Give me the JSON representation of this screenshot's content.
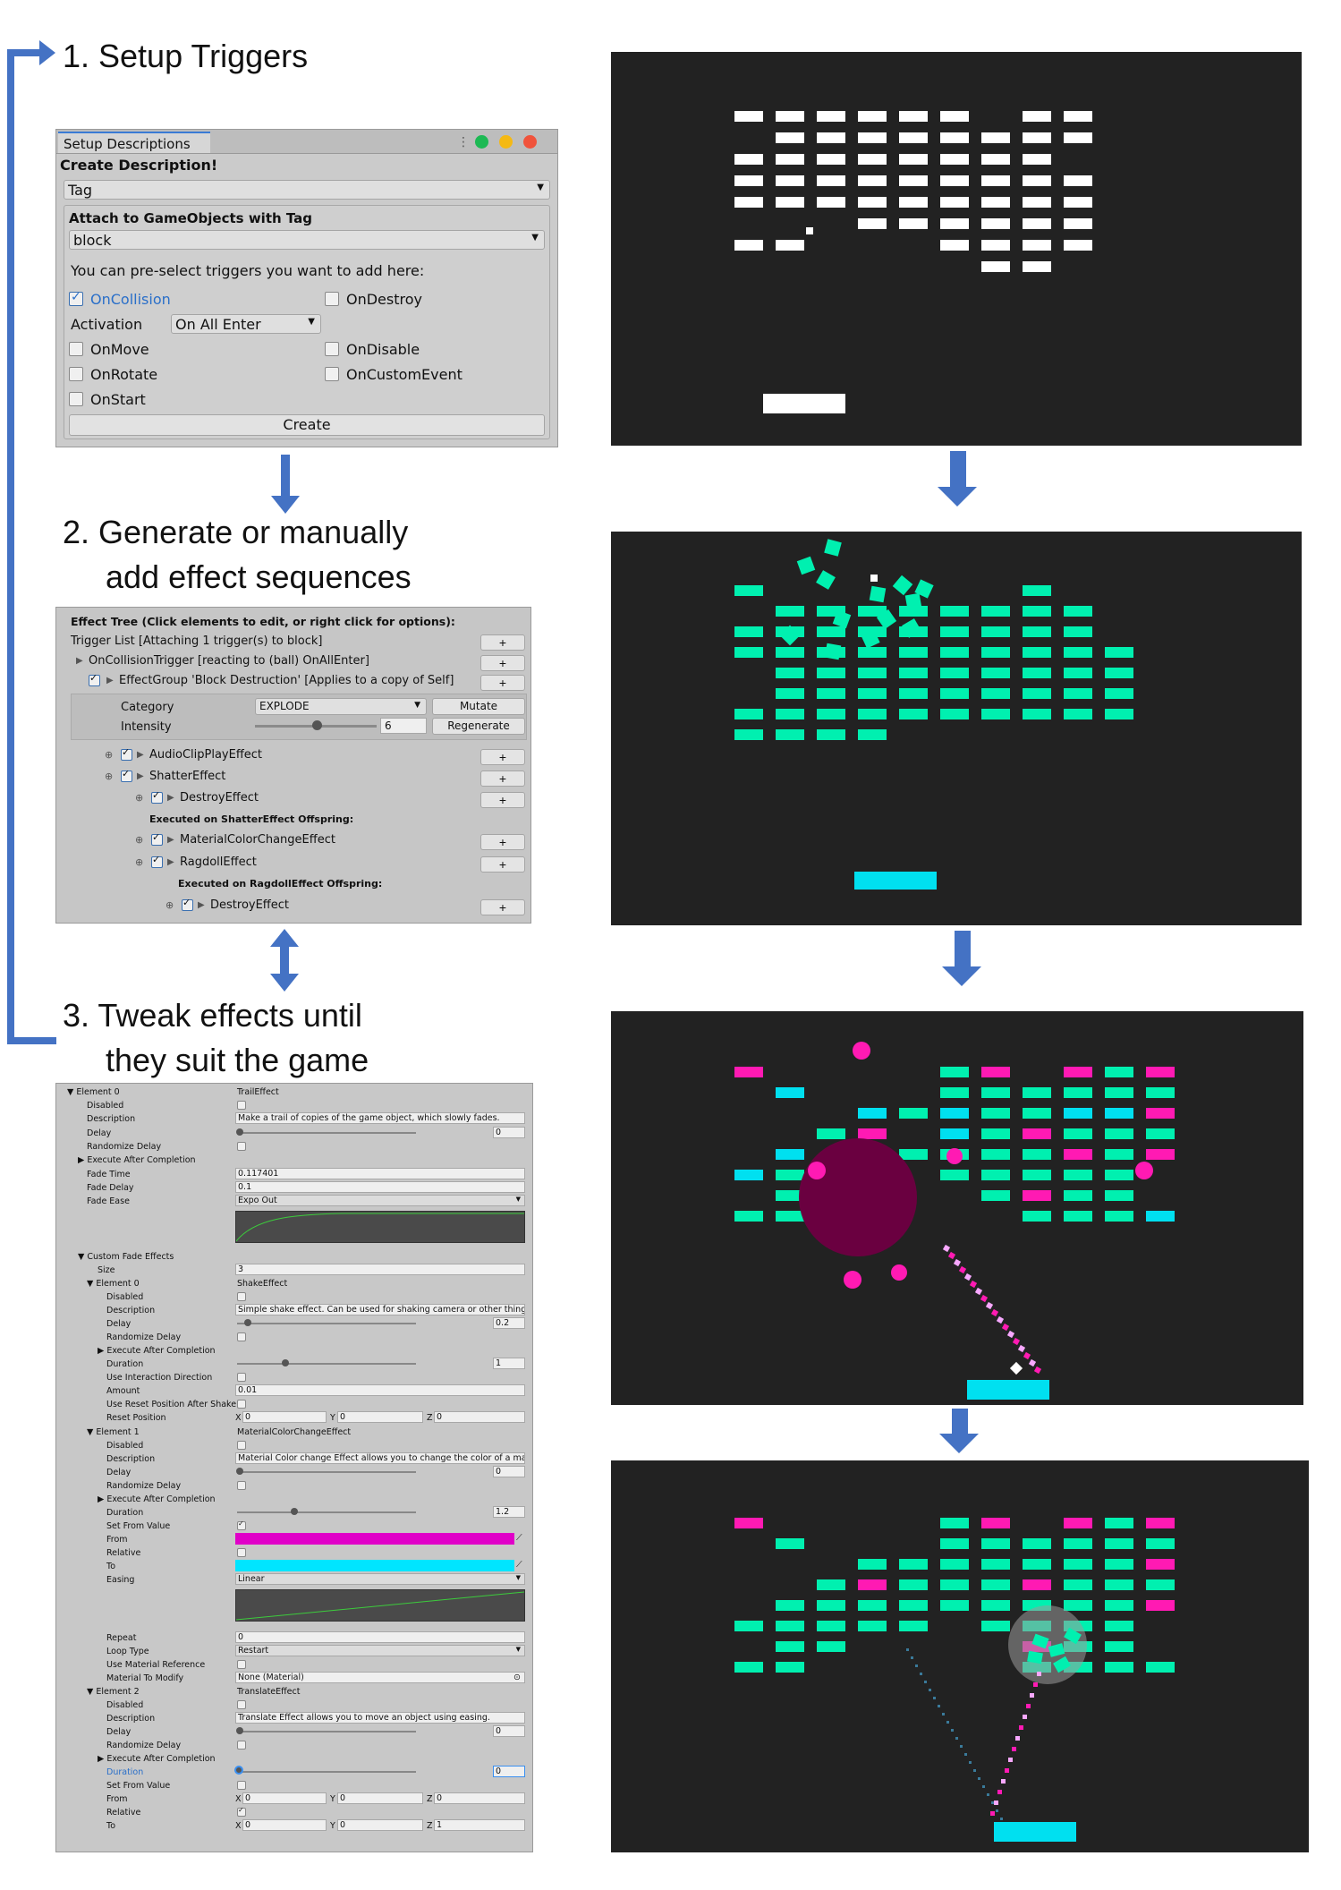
{
  "steps": [
    {
      "title": "1. Setup Triggers"
    },
    {
      "title_l1": "2. Generate or manually",
      "title_l2": "add effect sequences"
    },
    {
      "title_l1": "3. Tweak effects until",
      "title_l2": "they suit the game"
    }
  ],
  "setup_panel": {
    "tab": "Setup Descriptions",
    "header": "Create Description!",
    "type_select": "Tag",
    "attach_label": "Attach to GameObjects with Tag",
    "tag_select": "block",
    "hint": "You can pre-select triggers you want to add here:",
    "triggers": [
      "OnCollision",
      "OnDestroy",
      "OnMove",
      "OnDisable",
      "OnRotate",
      "OnCustomEvent",
      "OnStart"
    ],
    "checked": [
      "OnCollision"
    ],
    "activation_label": "Activation",
    "activation_value": "On All Enter",
    "create_button": "Create",
    "window_dots": [
      "#1db954",
      "#f5b914",
      "#f0533c"
    ]
  },
  "effect_tree": {
    "header": "Effect Tree (Click elements to edit, or right click for options):",
    "rows": [
      "Trigger List [Attaching 1 trigger(s) to block]",
      "OnCollisionTrigger [reacting to (ball) OnAllEnter]",
      "EffectGroup 'Block Destruction' [Applies to a copy of Self]"
    ],
    "category_label": "Category",
    "category_value": "EXPLODE",
    "mutate": "Mutate",
    "intensity_label": "Intensity",
    "intensity_value": "6",
    "regenerate": "Regenerate",
    "effects": [
      "AudioClipPlayEffect",
      "ShatterEffect",
      "DestroyEffect",
      "Executed on ShatterEffect Offspring:",
      "MaterialColorChangeEffect",
      "RagdollEffect",
      "Executed on RagdollEffect Offspring:",
      "DestroyEffect"
    ],
    "plus": "+"
  },
  "inspector": {
    "element0": "Element 0",
    "trail": "TrailEffect",
    "disabled": "Disabled",
    "description": "Description",
    "trail_desc": "Make a trail of copies of the game object, which slowly fades.",
    "delay": "Delay",
    "zero": "0",
    "randomize_delay": "Randomize Delay",
    "execute_after": "Execute After Completion",
    "fade_time": "Fade Time",
    "fade_time_v": "0.117401",
    "fade_delay": "Fade Delay",
    "fade_delay_v": "0.1",
    "fade_ease": "Fade Ease",
    "fade_ease_v": "Expo Out",
    "custom_fade": "Custom Fade Effects",
    "size": "Size",
    "size_v": "3",
    "shake": "ShakeEffect",
    "shake_desc": "Simple shake effect. Can be used for shaking camera or other things.",
    "shake_delay": "0.2",
    "duration": "Duration",
    "shake_dur": "1",
    "use_interaction": "Use Interaction Direction",
    "amount": "Amount",
    "amount_v": "0.01",
    "use_reset": "Use Reset Position After Shake",
    "reset_pos": "Reset Position",
    "x": "X",
    "y": "Y",
    "z": "Z",
    "one": "1",
    "element1": "Element 1",
    "mcc": "MaterialColorChangeEffect",
    "mcc_desc": "Material Color change Effect allows you to change the color of a material",
    "mcc_dur": "1.2",
    "set_from": "Set From Value",
    "from": "From",
    "relative": "Relative",
    "to": "To",
    "easing": "Easing",
    "linear": "Linear",
    "repeat": "Repeat",
    "loop_type": "Loop Type",
    "restart": "Restart",
    "use_mat_ref": "Use Material Reference",
    "mat_to_modify": "Material To Modify",
    "none_mat": "None (Material)",
    "element2": "Element 2",
    "translate": "TranslateEffect",
    "translate_desc": "Translate Effect allows you to move an object using easing.",
    "from_color": "#e000c8",
    "to_color": "#00e5ff"
  },
  "colors": {
    "arrow": "#4472c4",
    "game_bg": "#222222",
    "block_white": "#ffffff",
    "block_teal": "#00f0b0",
    "block_cyan": "#00e0f0",
    "block_magenta": "#ff1ab3",
    "explosion": "#6a0040"
  }
}
